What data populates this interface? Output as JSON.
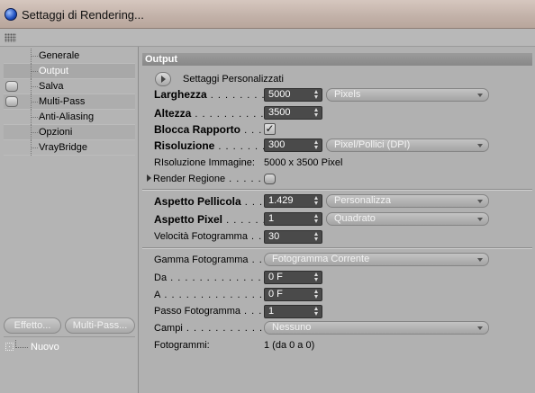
{
  "window": {
    "title": "Settaggi di Rendering..."
  },
  "sidebar": {
    "items": [
      {
        "label": "Generale"
      },
      {
        "label": "Output"
      },
      {
        "label": "Salva"
      },
      {
        "label": "Multi-Pass"
      },
      {
        "label": "Anti-Aliasing"
      },
      {
        "label": "Opzioni"
      },
      {
        "label": "VrayBridge"
      }
    ],
    "effect_button": "Effetto...",
    "multipass_button": "Multi-Pass...",
    "new_item": "Nuovo"
  },
  "output": {
    "section_title": "Output",
    "preset_label": "Settaggi  Personalizzati",
    "width": {
      "label": "Larghezza",
      "dots": " . . . . . . . . . .",
      "value": "5000",
      "unit": "Pixels"
    },
    "height": {
      "label": "Altezza",
      "dots": " . . . . . . . . . . . .",
      "value": "3500"
    },
    "lock_ratio": {
      "label": "Blocca Rapporto",
      "dots": " . . . .",
      "checked": true,
      "mark": "✓"
    },
    "resolution": {
      "label": "Risoluzione",
      "dots": " . . . . . . . . . .",
      "value": "300",
      "unit": "Pixel/Pollici (DPI)"
    },
    "image_resolution": {
      "label": "RIsoluzione Immagine:",
      "value": "5000 x 3500 Pixel"
    },
    "render_region": {
      "label": "Render Regione",
      "dots": " . . . . . . ."
    },
    "film_aspect": {
      "label": "Aspetto Pellicola",
      "dots": " . . .",
      "value": "1.429",
      "preset": "Personalizza"
    },
    "pixel_aspect": {
      "label": "Aspetto Pixel",
      "dots": " . . . . . . . .",
      "value": "1",
      "preset": "Quadrato"
    },
    "frame_rate": {
      "label": "Velocità Fotogramma",
      "dots": " . . .",
      "value": "30"
    },
    "frame_range": {
      "label": "Gamma Fotogramma",
      "dots": " . . .",
      "value": "Fotogramma Corrente"
    },
    "from": {
      "label": "Da",
      "dots": " . . . . . . . . . . . . . . . . . . . . . . .",
      "value": "0 F"
    },
    "to": {
      "label": "A",
      "dots": " . . . . . . . . . . . . . . . . . . . . . . . .",
      "value": "0 F"
    },
    "frame_step": {
      "label": "Passo Fotogramma",
      "dots": " . . . . .",
      "value": "1"
    },
    "fields": {
      "label": "Campi",
      "dots": " . . . . . . . . . . . . . . . . .",
      "value": "Nessuno"
    },
    "frames": {
      "label": "Fotogrammi:",
      "value": "1 (da 0 a 0)"
    }
  }
}
